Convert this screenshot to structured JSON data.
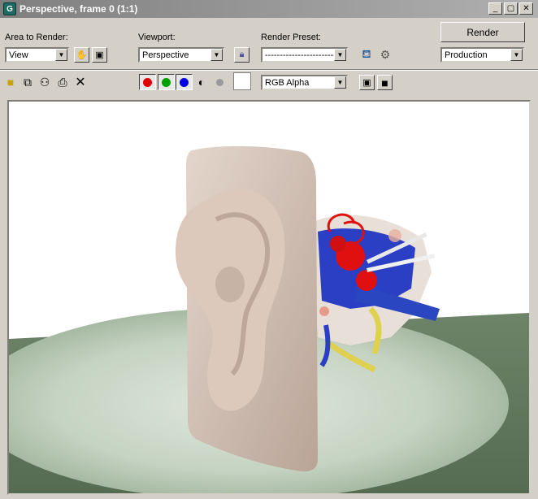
{
  "window": {
    "title": "Perspective, frame 0 (1:1)",
    "app_icon_letter": "G"
  },
  "controls": {
    "area_label": "Area to Render:",
    "area_value": "View",
    "viewport_label": "Viewport:",
    "viewport_value": "Perspective",
    "preset_label": "Render Preset:",
    "preset_value": "---------------------------",
    "render_button": "Render",
    "render_mode_value": "Production",
    "channel_value": "RGB Alpha"
  },
  "colors": {
    "title_bar_start": "#7f7f7f",
    "red_channel": "#e00000",
    "green_channel": "#00a000",
    "blue_channel": "#0000e0"
  },
  "icons": [
    "save-icon",
    "copy-icon",
    "clone-icon",
    "print-icon",
    "clear-icon",
    "red-channel-icon",
    "green-channel-icon",
    "blue-channel-icon",
    "mono-icon",
    "alpha-icon"
  ]
}
